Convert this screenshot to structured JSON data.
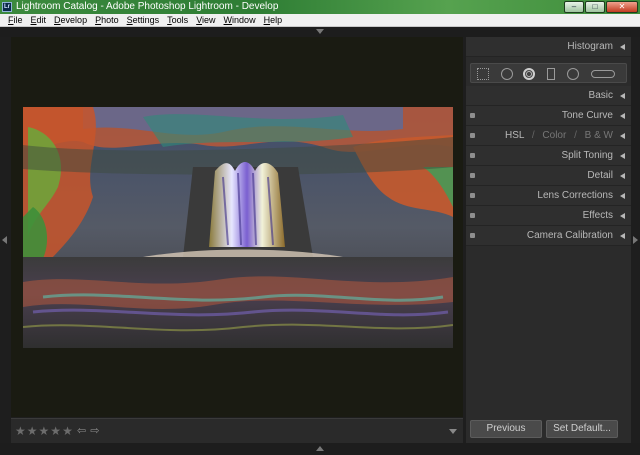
{
  "window": {
    "title": "Lightroom Catalog - Adobe Photoshop Lightroom - Develop",
    "icon_text": "Lr",
    "minimize": "–",
    "maximize": "□",
    "close": "✕"
  },
  "menu": [
    "File",
    "Edit",
    "Develop",
    "Photo",
    "Settings",
    "Tools",
    "View",
    "Window",
    "Help"
  ],
  "panel": {
    "histogram": "Histogram",
    "sections": {
      "basic": "Basic",
      "tone_curve": "Tone Curve",
      "hsl": "HSL",
      "color": "Color",
      "bw": "B & W",
      "hsl_sep": "/",
      "split_toning": "Split Toning",
      "detail": "Detail",
      "lens_corrections": "Lens Corrections",
      "effects": "Effects",
      "camera_calibration": "Camera Calibration"
    },
    "tools": [
      "grid-overlay-icon",
      "crop-icon",
      "spot-removal-icon",
      "graduated-filter-icon",
      "radial-filter-icon",
      "adjustment-brush-icon"
    ],
    "previous_label": "Previous",
    "set_default_label": "Set Default..."
  },
  "toolbar": {
    "stars": [
      "★",
      "★",
      "★",
      "★",
      "★"
    ],
    "left_arrow": "⇦",
    "right_arrow": "⇨"
  }
}
